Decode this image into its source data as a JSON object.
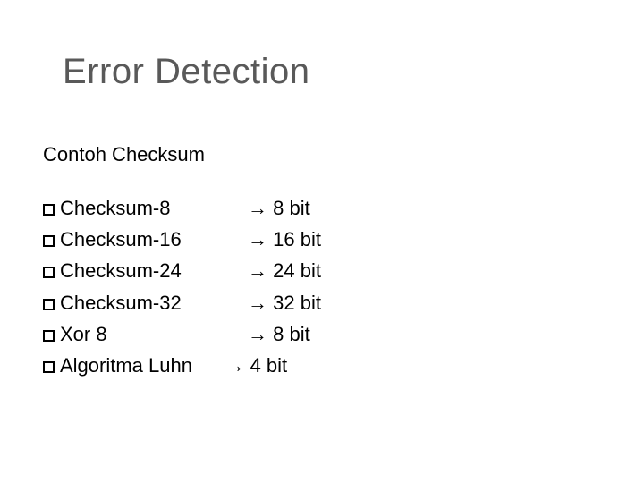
{
  "title": "Error Detection",
  "subtitle": "Contoh Checksum",
  "arrow": "→",
  "items": [
    {
      "name": "Checksum-8",
      "value": "8 bit"
    },
    {
      "name": "Checksum-16",
      "value": "16 bit"
    },
    {
      "name": "Checksum-24",
      "value": "24 bit"
    },
    {
      "name": "Checksum-32",
      "value": "32 bit"
    },
    {
      "name": "Xor 8",
      "value": "8 bit"
    },
    {
      "name": "Algoritma Luhn",
      "value": "4 bit"
    }
  ]
}
